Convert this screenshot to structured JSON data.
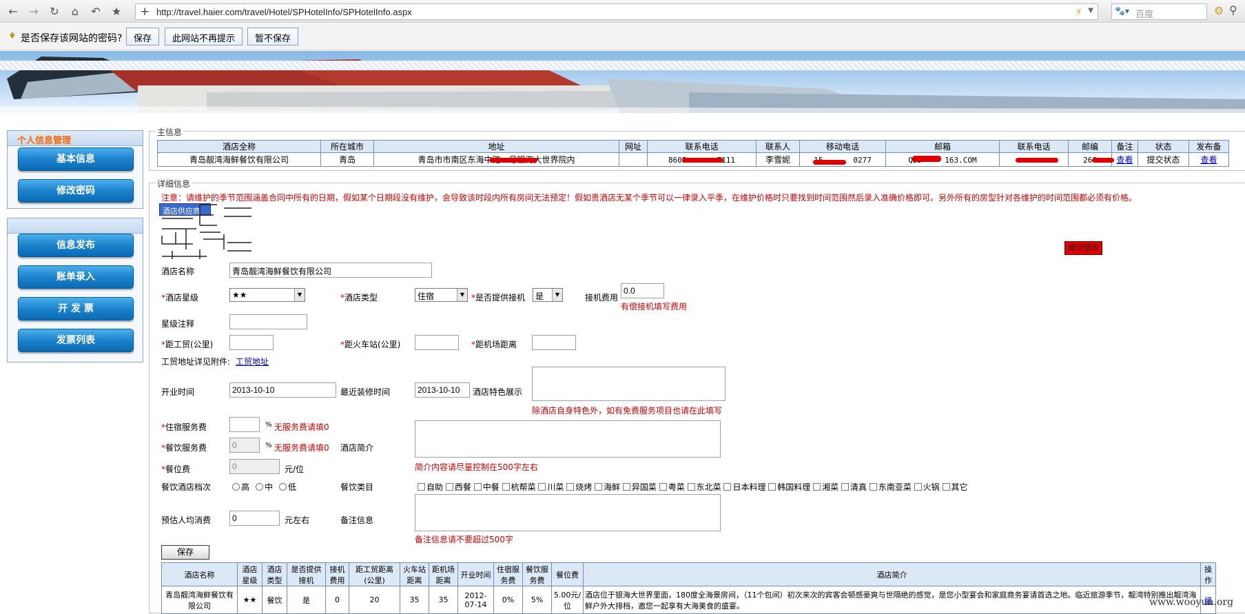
{
  "browser": {
    "url": "http://travel.haier.com/travel/Hotel/SPHotelInfo/SPHotelInfo.aspx",
    "search_placeholder": "百度"
  },
  "password_bar": {
    "prompt": "是否保存该网站的密码?",
    "save": "保存",
    "never": "此网站不再提示",
    "not_now": "暂不保存"
  },
  "sidebar": {
    "section1_title": "个人信息管理",
    "basic_info": "基本信息",
    "change_password": "修改密码",
    "publish_info": "信息发布",
    "bill_entry": "账单录入",
    "issue_invoice": "开 发 票",
    "invoice_list": "发票列表"
  },
  "main_info": {
    "legend": "主信息",
    "headers": [
      "酒店全称",
      "所在城市",
      "地址",
      "网址",
      "联系电话",
      "联系人",
      "移动电话",
      "邮箱",
      "联系电话",
      "邮编",
      "备注",
      "状态",
      "发布备"
    ],
    "row": {
      "name": "青岛靓湾海鲜餐饮有限公司",
      "city": "青岛",
      "address": "青岛市市南区东海中路　号银海大世界院内",
      "website": "",
      "phone": "8605　　　　7111",
      "contact": "李雪妮",
      "mobile": "15　　　　0277",
      "email": "QDD　　　163.COM",
      "phone2": "",
      "zipcode": "266　　",
      "remark_link": "查看",
      "status": "提交状态",
      "publish_link": "查看"
    }
  },
  "detail": {
    "legend": "详细信息",
    "notice": "注意：请维护的季节范围涵盖合同中所有的日期，假如某个日期段没有维护，会导致该时段内所有房间无法预定！假如贵酒店无某个季节可以一律录入平季，在维护价格时只要找到时间范围然后录入准确价格即可。另外所有的房型针对各维护的时间范围都必须有价格。",
    "tab_label": "酒店供应商",
    "submit_edit": "提交修改",
    "hotel_name_label": "酒店名称",
    "hotel_name_value": "青岛靓湾海鲜餐饮有限公司",
    "star_label": "*酒店星级",
    "star_value": "★★",
    "type_label": "*酒店类型",
    "type_value": "住宿",
    "pickup_label": "*是否提供接机",
    "pickup_value": "是",
    "pickup_fee_label": "接机费用",
    "pickup_fee_value": "0.0",
    "pickup_fee_hint": "有偿接机填写费用",
    "star_note_label": "星级注释",
    "dist_trade_label": "*距工贸(公里)",
    "dist_train_label": "*距火车站(公里)",
    "dist_airport_label": "*距机场距离",
    "trade_addr_label": "工贸地址详见附件:",
    "trade_addr_link": "工贸地址",
    "open_label": "开业时间",
    "open_value": "2013-10-10",
    "renov_label": "最近装修时间",
    "renov_value": "2013-10-10",
    "feature_label": "酒店特色展示",
    "feature_hint": "除酒店自身特色外，如有免费服务项目也请在此填写",
    "lodge_fee_label": "*住宿服务费",
    "lodge_fee_hint": "无服务费请填0",
    "dining_fee_label": "*餐饮服务费",
    "dining_fee_value": "0",
    "dining_fee_hint": "无服务费请填0",
    "intro_label": "酒店简介",
    "intro_hint": "简介内容请尽量控制在500字左右",
    "seat_fee_label": "*餐位费",
    "seat_fee_value": "0",
    "seat_fee_unit": "元/位",
    "grade_label": "餐饮酒店档次",
    "grade_options": [
      "高",
      "中",
      "低"
    ],
    "cuisine_label": "餐饮类目",
    "cuisines": [
      "自助",
      "西餐",
      "中餐",
      "杭帮菜",
      "川菜",
      "烧烤",
      "海鲜",
      "异国菜",
      "粤菜",
      "东北菜",
      "日本料理",
      "韩国料理",
      "湘菜",
      "清真",
      "东南亚菜",
      "火锅",
      "其它"
    ],
    "avg_label": "预估人均消费",
    "avg_value": "0",
    "avg_unit": "元左右",
    "remark_label": "备注信息",
    "remark_hint": "备注信息请不要超过500字",
    "save": "保存",
    "percent": "%"
  },
  "bottom_table": {
    "headers": [
      "酒店名称",
      "酒店星级",
      "酒店类型",
      "是否提供接机",
      "接机费用",
      "距工贸距离(公里)",
      "火车站距离",
      "距机场距离",
      "开业时间",
      "住宿服务费",
      "餐饮服务费",
      "餐位费",
      "酒店简介",
      "操作"
    ],
    "row": {
      "name": "青岛靓湾海鲜餐饮有限公司",
      "star": "★★",
      "type": "餐饮",
      "pickup": "是",
      "pickup_fee": "0",
      "dist_trade": "20",
      "dist_train": "35",
      "dist_airport": "35",
      "open": "2012-07-14",
      "lodge_fee": "0%",
      "dining_fee": "5%",
      "seat_fee": "5.00元/位",
      "intro": "酒店位于银海大世界里面，180度全海景房间，（11个包间）初次来次的宾客会顿感豪爽与世隔绝的感觉，是您小型宴会和家庭商务宴请首选之地。临近旅游季节，靓湾特别推出靓湾海鲜户外大排档，邀您一起享有大海美食的盛宴。",
      "op": "编"
    }
  },
  "watermark": "www.wooyun.org"
}
